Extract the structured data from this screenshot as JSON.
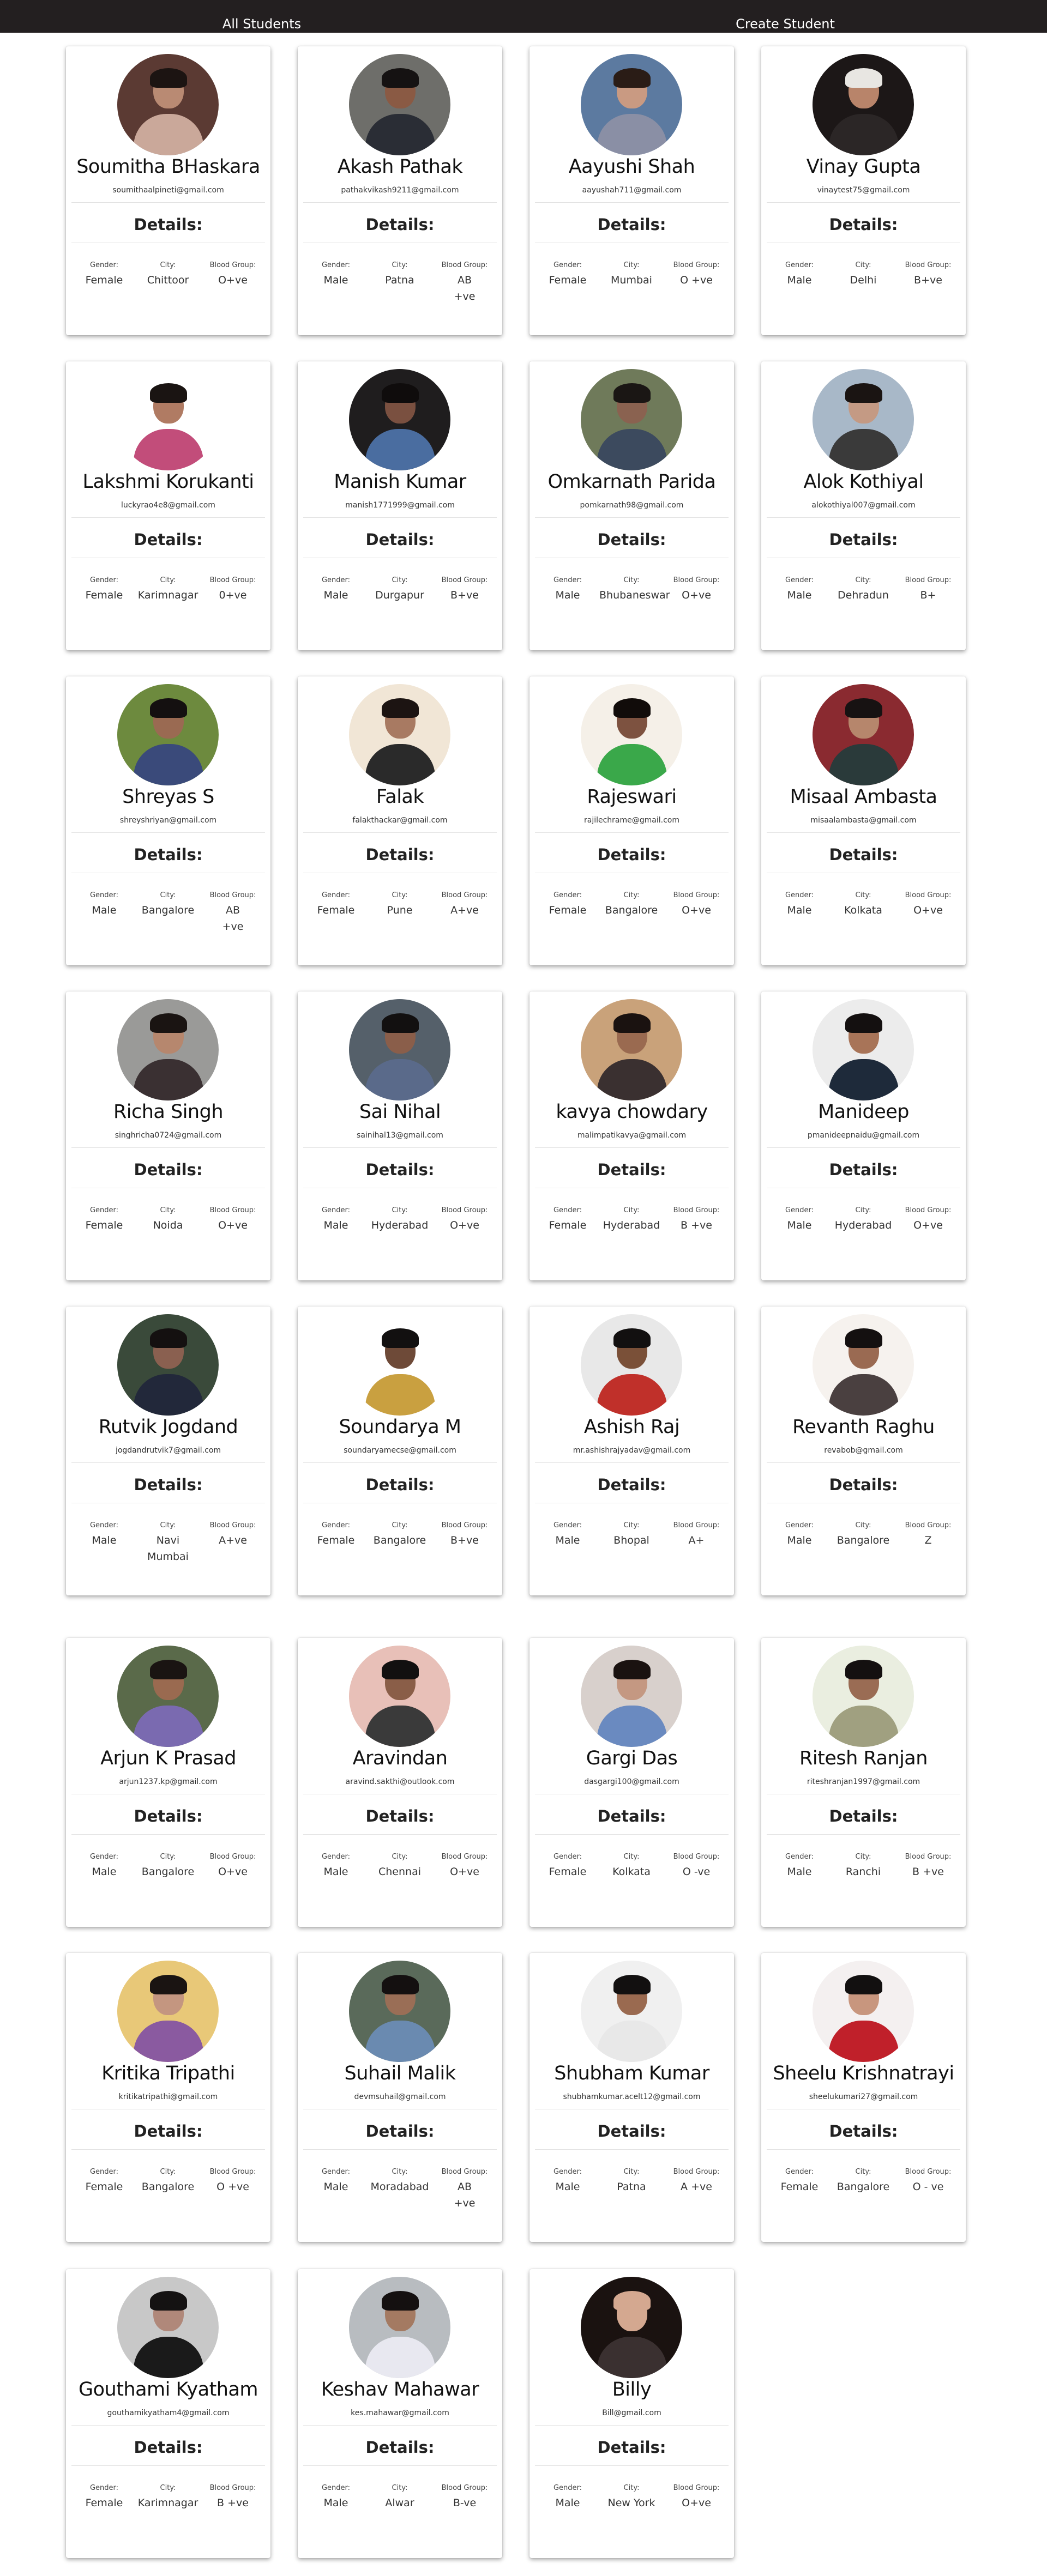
{
  "navbar": {
    "all_students": "All Students",
    "create_student": "Create Student"
  },
  "card_labels": {
    "details": "Details:",
    "gender": "Gender:",
    "city": "City:",
    "blood_group": "Blood Group:"
  },
  "students": [
    {
      "name": "Soumitha BHaskara",
      "email": "soumithaalpineti@gmail.com",
      "gender": "Female",
      "city": "Chittoor",
      "blood": "O+ve",
      "colors": {
        "bg": "#5b3a33",
        "skin": "#b98a73",
        "hair": "#1c1412",
        "shirt": "#caa89a"
      }
    },
    {
      "name": "Akash Pathak",
      "email": "pathakvikash9211@gmail.com",
      "gender": "Male",
      "city": "Patna",
      "blood": "AB +ve",
      "colors": {
        "bg": "#6e6e6a",
        "skin": "#8a5a44",
        "hair": "#151212",
        "shirt": "#2a2d35"
      }
    },
    {
      "name": "Aayushi Shah",
      "email": "aayushah711@gmail.com",
      "gender": "Female",
      "city": "Mumbai",
      "blood": "O +ve",
      "colors": {
        "bg": "#5c7aa0",
        "skin": "#c99a82",
        "hair": "#2a1c16",
        "shirt": "#8a8fa5"
      }
    },
    {
      "name": "Vinay Gupta",
      "email": "vinaytest75@gmail.com",
      "gender": "Male",
      "city": "Delhi",
      "blood": "B+ve",
      "colors": {
        "bg": "#1c1717",
        "skin": "#b8846a",
        "hair": "#e8e6e2",
        "shirt": "#2b2626"
      }
    },
    {
      "name": "Lakshmi Korukanti",
      "email": "luckyrao4e8@gmail.com",
      "gender": "Female",
      "city": "Karimnagar",
      "blood": "0+ve",
      "colors": {
        "bg": "#ffffff",
        "skin": "#b07b63",
        "hair": "#1a1412",
        "shirt": "#c24d7a"
      }
    },
    {
      "name": "Manish Kumar",
      "email": "manish1771999@gmail.com",
      "gender": "Male",
      "city": "Durgapur",
      "blood": "B+ve",
      "colors": {
        "bg": "#1f1d1e",
        "skin": "#7a5040",
        "hair": "#0f0c0c",
        "shirt": "#4a6da0"
      }
    },
    {
      "name": "Omkarnath Parida",
      "email": "pomkarnath98@gmail.com",
      "gender": "Male",
      "city": "Bhubaneswar",
      "blood": "O+ve",
      "colors": {
        "bg": "#6f7a5a",
        "skin": "#8a6250",
        "hair": "#1a1614",
        "shirt": "#3c4a5e"
      }
    },
    {
      "name": "Alok Kothiyal",
      "email": "alokothiyal007@gmail.com",
      "gender": "Male",
      "city": "Dehradun",
      "blood": "B+",
      "colors": {
        "bg": "#a8b8c8",
        "skin": "#c49a84",
        "hair": "#1a1412",
        "shirt": "#3a3a3a"
      }
    },
    {
      "name": "Shreyas S",
      "email": "shreyshriyan@gmail.com",
      "gender": "Male",
      "city": "Bangalore",
      "blood": "AB +ve",
      "colors": {
        "bg": "#6d8a3e",
        "skin": "#9a6a52",
        "hair": "#141010",
        "shirt": "#3a4a7a"
      }
    },
    {
      "name": "Falak",
      "email": "falakthackar@gmail.com",
      "gender": "Female",
      "city": "Pune",
      "blood": "A+ve",
      "colors": {
        "bg": "#f1e6d6",
        "skin": "#a87a62",
        "hair": "#1c1412",
        "shirt": "#2a2a2a"
      }
    },
    {
      "name": "Rajeswari",
      "email": "rajilechrame@gmail.com",
      "gender": "Female",
      "city": "Bangalore",
      "blood": "O+ve",
      "colors": {
        "bg": "#f5f0e8",
        "skin": "#7d5240",
        "hair": "#110c0a",
        "shirt": "#3aa84a"
      }
    },
    {
      "name": "Misaal Ambasta",
      "email": "misaalambasta@gmail.com",
      "gender": "Male",
      "city": "Kolkata",
      "blood": "O+ve",
      "colors": {
        "bg": "#8a2a30",
        "skin": "#b6866c",
        "hair": "#171212",
        "shirt": "#2a3a3a"
      }
    },
    {
      "name": "Richa Singh",
      "email": "singhricha0724@gmail.com",
      "gender": "Female",
      "city": "Noida",
      "blood": "O+ve",
      "colors": {
        "bg": "#9a9a98",
        "skin": "#b6876e",
        "hair": "#1a1412",
        "shirt": "#3a3032"
      }
    },
    {
      "name": "Sai Nihal",
      "email": "sainihal13@gmail.com",
      "gender": "Male",
      "city": "Hyderabad",
      "blood": "O+ve",
      "colors": {
        "bg": "#55606a",
        "skin": "#8a5e4a",
        "hair": "#121010",
        "shirt": "#5a6a8a"
      }
    },
    {
      "name": "kavya chowdary",
      "email": "malimpatikavya@gmail.com",
      "gender": "Female",
      "city": "Hyderabad",
      "blood": "B +ve",
      "colors": {
        "bg": "#c9a27a",
        "skin": "#9a6a50",
        "hair": "#1a1210",
        "shirt": "#3a3030"
      }
    },
    {
      "name": "Manideep",
      "email": "pmanideepnaidu@gmail.com",
      "gender": "Male",
      "city": "Hyderabad",
      "blood": "O+ve",
      "colors": {
        "bg": "#ececec",
        "skin": "#a87458",
        "hair": "#141010",
        "shirt": "#1e2a3a"
      }
    },
    {
      "name": "Rutvik Jogdand",
      "email": "jogdandrutvik7@gmail.com",
      "gender": "Male",
      "city": "Navi Mumbai",
      "blood": "A+ve",
      "colors": {
        "bg": "#3a4a3a",
        "skin": "#8a6050",
        "hair": "#141010",
        "shirt": "#22283a"
      }
    },
    {
      "name": "Soundarya M",
      "email": "soundaryamecse@gmail.com",
      "gender": "Female",
      "city": "Bangalore",
      "blood": "B+ve",
      "colors": {
        "bg": "#ffffff",
        "skin": "#6e4a38",
        "hair": "#121010",
        "shirt": "#c9a040"
      }
    },
    {
      "name": "Ashish Raj",
      "email": "mr.ashishrajyadav@gmail.com",
      "gender": "Male",
      "city": "Bhopal",
      "blood": "A+",
      "colors": {
        "bg": "#e8e8e8",
        "skin": "#7a5038",
        "hair": "#121010",
        "shirt": "#c0302a"
      }
    },
    {
      "name": "Revanth Raghu",
      "email": "revabob@gmail.com",
      "gender": "Male",
      "city": "Bangalore",
      "blood": "Z",
      "colors": {
        "bg": "#f6f2ee",
        "skin": "#9a6a52",
        "hair": "#141010",
        "shirt": "#4a4040"
      }
    },
    {
      "name": "Arjun K Prasad",
      "email": "arjun1237.kp@gmail.com",
      "gender": "Male",
      "city": "Bangalore",
      "blood": "O+ve",
      "colors": {
        "bg": "#5a6a4a",
        "skin": "#9a6a50",
        "hair": "#1a1412",
        "shirt": "#7a6ab0"
      }
    },
    {
      "name": "Aravindan",
      "email": "aravind.sakthi@outlook.com",
      "gender": "Male",
      "city": "Chennai",
      "blood": "O+ve",
      "colors": {
        "bg": "#e8c0b8",
        "skin": "#8a5e48",
        "hair": "#121010",
        "shirt": "#3a3a3a"
      }
    },
    {
      "name": "Gargi Das",
      "email": "dasgargi100@gmail.com",
      "gender": "Female",
      "city": "Kolkata",
      "blood": "O -ve",
      "colors": {
        "bg": "#d8d0cc",
        "skin": "#c49882",
        "hair": "#1a1210",
        "shirt": "#6a8ac0"
      }
    },
    {
      "name": "Ritesh Ranjan",
      "email": "riteshranjan1997@gmail.com",
      "gender": "Male",
      "city": "Ranchi",
      "blood": "B +ve",
      "colors": {
        "bg": "#eaeee0",
        "skin": "#9a6c54",
        "hair": "#141010",
        "shirt": "#a0a080"
      }
    },
    {
      "name": "Kritika Tripathi",
      "email": "kritikatripathi@gmail.com",
      "gender": "Female",
      "city": "Bangalore",
      "blood": "O +ve",
      "colors": {
        "bg": "#e8c878",
        "skin": "#c49680",
        "hair": "#1a1412",
        "shirt": "#8a5aa0"
      }
    },
    {
      "name": "Suhail Malik",
      "email": "devmsuhail@gmail.com",
      "gender": "Male",
      "city": "Moradabad",
      "blood": "AB +ve",
      "colors": {
        "bg": "#5a6a5a",
        "skin": "#9a6e56",
        "hair": "#141010",
        "shirt": "#6a8ab0"
      }
    },
    {
      "name": "Shubham Kumar",
      "email": "shubhamkumar.acelt12@gmail.com",
      "gender": "Male",
      "city": "Patna",
      "blood": "A +ve",
      "colors": {
        "bg": "#f0f0f0",
        "skin": "#9a6a50",
        "hair": "#121010",
        "shirt": "#e8e8e8"
      }
    },
    {
      "name": "Sheelu Krishnatrayi",
      "email": "sheelukumari27@gmail.com",
      "gender": "Female",
      "city": "Bangalore",
      "blood": "O - ve",
      "colors": {
        "bg": "#f4f0f0",
        "skin": "#c8967e",
        "hair": "#121010",
        "shirt": "#c0202a"
      }
    },
    {
      "name": "Gouthami Kyatham",
      "email": "gouthamikyatham4@gmail.com",
      "gender": "Female",
      "city": "Karimnagar",
      "blood": "B +ve",
      "colors": {
        "bg": "#c8c8c8",
        "skin": "#b0887a",
        "hair": "#141212",
        "shirt": "#1a1a1a"
      }
    },
    {
      "name": "Keshav Mahawar",
      "email": "kes.mahawar@gmail.com",
      "gender": "Male",
      "city": "Alwar",
      "blood": "B-ve",
      "colors": {
        "bg": "#b8bcc0",
        "skin": "#a47a62",
        "hair": "#141010",
        "shirt": "#e8e8f0"
      }
    },
    {
      "name": "Billy",
      "email": "Bill@gmail.com",
      "gender": "Male",
      "city": "New York",
      "blood": "O+ve",
      "colors": {
        "bg": "#1a1210",
        "skin": "#d4a890",
        "hair": "#d4a890",
        "shirt": "#3a3030"
      }
    }
  ]
}
